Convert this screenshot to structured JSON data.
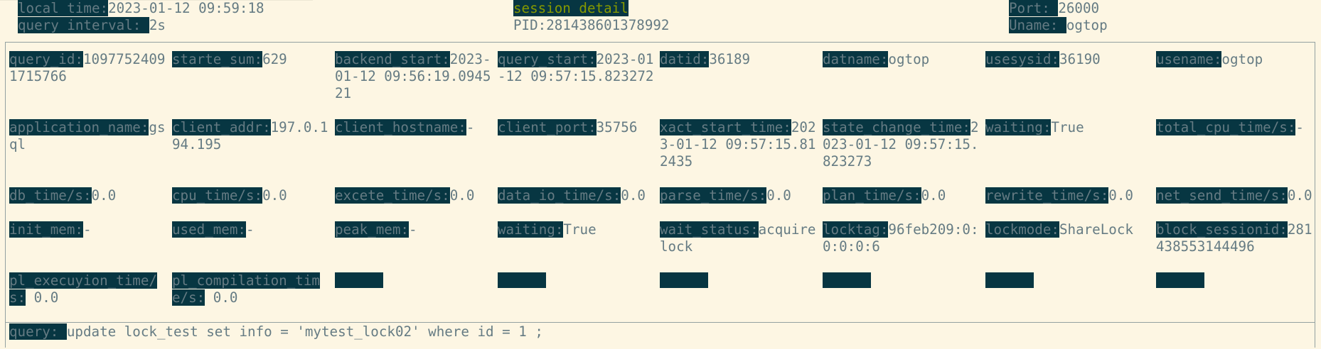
{
  "header": {
    "local_time_label": "local time:",
    "local_time_value": "2023-01-12 09:59:18",
    "query_interval_label": "query interval: ",
    "query_interval_value": "2s",
    "title": "session detail",
    "pid_text": "PID:281438601378992",
    "port_label": "Port: ",
    "port_value": "26000",
    "uname_label": "Uname: ",
    "uname_value": "ogtop"
  },
  "rows": [
    [
      {
        "label": "query_id:",
        "value": "10977524091715766"
      },
      {
        "label": "starte_sum:",
        "value": "629"
      },
      {
        "label": "backend_start:",
        "value": "2023-01-12 09:56:19.094521"
      },
      {
        "label": "query_start:",
        "value": "2023-01-12 09:57:15.823272"
      },
      {
        "label": "datid:",
        "value": "36189"
      },
      {
        "label": "datname:",
        "value": "ogtop"
      },
      {
        "label": "usesysid:",
        "value": "36190"
      },
      {
        "label": "usename:",
        "value": "ogtop"
      }
    ],
    [
      {
        "label": "application_name:",
        "value": "gsql"
      },
      {
        "label": "client_addr:",
        "value": "197.0.194.195"
      },
      {
        "label": "client_hostname:",
        "value": "-"
      },
      {
        "label": "client_port:",
        "value": "35756"
      },
      {
        "label": "xact_start_time:",
        "value": "2023-01-12 09:57:15.812435"
      },
      {
        "label": "state_change_time:",
        "value": "2023-01-12 09:57:15.823273"
      },
      {
        "label": "waiting:",
        "value": "True"
      },
      {
        "label": "total_cpu_time/s:",
        "value": "-"
      }
    ],
    [
      {
        "label": "db_time/s:",
        "value": "0.0"
      },
      {
        "label": "cpu_time/s:",
        "value": "0.0"
      },
      {
        "label": "excete_time/s:",
        "value": "0.0"
      },
      {
        "label": "data_io_time/s:",
        "value": "0.0"
      },
      {
        "label": "parse_time/s:",
        "value": "0.0"
      },
      {
        "label": "plan_time/s:",
        "value": "0.0"
      },
      {
        "label": "rewrite_time/s:",
        "value": "0.0"
      },
      {
        "label": "net_send_time/s:",
        "value": "0.0"
      }
    ],
    [
      {
        "label": "init_mem:",
        "value": "-"
      },
      {
        "label": "used_mem:",
        "value": "-"
      },
      {
        "label": "peak_mem:",
        "value": "-"
      },
      {
        "label": "waiting:",
        "value": "True"
      },
      {
        "label": "wait_status:",
        "value": "acquire lock"
      },
      {
        "label": "locktag:",
        "value": "96feb209:0:0:0:0:6"
      },
      {
        "label": "lockmode:",
        "value": "ShareLock"
      },
      {
        "label": "block_sessionid:",
        "value": "281438553144496"
      }
    ],
    [
      {
        "label": "pl_execuyion_time/s:",
        "value": " 0.0"
      },
      {
        "label": "pl_compilation_time/s:",
        "value": " 0.0"
      }
    ]
  ],
  "query": {
    "label": "query: ",
    "value": "update lock_test set info = 'mytest_lock02' where id = 1 ;"
  }
}
